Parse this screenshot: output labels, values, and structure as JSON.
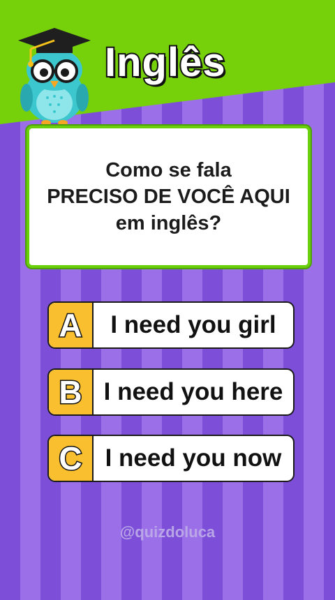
{
  "header": {
    "title": "Inglês",
    "mascot_icon": "owl-graduate-icon",
    "band_color": "#76d10a"
  },
  "question": {
    "lines": [
      "Como se fala",
      "PRECISO DE VOCÊ AQUI",
      "em inglês?"
    ]
  },
  "options": [
    {
      "letter": "A",
      "text": "I need you girl"
    },
    {
      "letter": "B",
      "text": "I need you here"
    },
    {
      "letter": "C",
      "text": "I need you now"
    }
  ],
  "watermark": "@quizdoluca",
  "colors": {
    "stripe_dark": "#7d4fd8",
    "stripe_light": "#9a6fe7",
    "letter_badge": "#f9bf2e",
    "card_border": "#6ad00c"
  }
}
